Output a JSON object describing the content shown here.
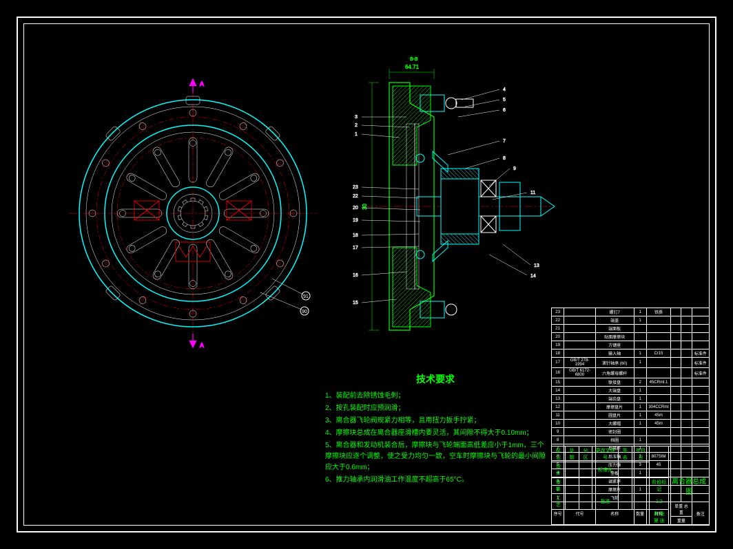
{
  "tech_req": {
    "title": "技术要求",
    "items": [
      "1、装配前去除锈蚀毛刺；",
      "2、按孔装配时应预润滑；",
      "3、离合器飞轮阀规紧力相等，且用扭力扳手拧紧；",
      "4、摩擦块总成在离合器座滑槽内要灵活，其间隙不得大于0.10mm；",
      "5、离合器和发动机装合后，摩擦块与飞轮端面高低差应小于1mm，三个摩擦块应逐个调整，使之受力均匀一致，空车时摩擦块与飞轮的最小间隙应大于0.6mm；",
      "6、推力轴承内润滑油工作温度不超高于65°C。"
    ]
  },
  "parts": [
    {
      "n": "23",
      "code": "",
      "name": "螺钉7",
      "qty": "1",
      "mat": "铁质",
      "wt": "",
      "note": ""
    },
    {
      "n": "22",
      "code": "",
      "name": "端盖",
      "qty": "1",
      "mat": "",
      "wt": "",
      "note": ""
    },
    {
      "n": "21",
      "code": "",
      "name": "端面板",
      "qty": "",
      "mat": "",
      "wt": "",
      "note": ""
    },
    {
      "n": "20",
      "code": "",
      "name": "贴面摩擦块",
      "qty": "",
      "mat": "",
      "wt": "",
      "note": ""
    },
    {
      "n": "19",
      "code": "",
      "name": "方键座",
      "qty": "",
      "mat": "",
      "wt": "",
      "note": ""
    },
    {
      "n": "18",
      "code": "",
      "name": "输入轴",
      "qty": "1",
      "mat": "Cr15",
      "wt": "",
      "note": "标准件"
    },
    {
      "n": "17",
      "code": "GB/T 278-1994",
      "name": "滚针轴承 (60)",
      "qty": "1",
      "mat": "",
      "wt": "",
      "note": "标准件"
    },
    {
      "n": "16",
      "code": "GB/T 6172-6800",
      "name": "六角螺母螺杆",
      "qty": "",
      "mat": "",
      "wt": "",
      "note": "标准件"
    },
    {
      "n": "15",
      "code": "",
      "name": "联接盘",
      "qty": "2",
      "mat": "45CRml.1",
      "wt": "",
      "note": ""
    },
    {
      "n": "14",
      "code": "",
      "name": "大端盘",
      "qty": "1",
      "mat": "",
      "wt": "",
      "note": ""
    },
    {
      "n": "13",
      "code": "",
      "name": "端齿盘",
      "qty": "1",
      "mat": "",
      "wt": "",
      "note": ""
    },
    {
      "n": "12",
      "code": "",
      "name": "摩擦盘片",
      "qty": "1",
      "mat": "304CCRml",
      "wt": "",
      "note": ""
    },
    {
      "n": "11",
      "code": "",
      "name": "圆盘片",
      "qty": "1",
      "mat": "45m",
      "wt": "",
      "note": ""
    },
    {
      "n": "10",
      "code": "",
      "name": "大螺帽",
      "qty": "1",
      "mat": "45m",
      "wt": "",
      "note": ""
    },
    {
      "n": "9",
      "code": "",
      "name": "密封圈",
      "qty": "",
      "mat": "",
      "wt": "",
      "note": ""
    },
    {
      "n": "8",
      "code": "",
      "name": "挡圈",
      "qty": "1",
      "mat": "",
      "wt": "",
      "note": ""
    },
    {
      "n": "7",
      "code": "",
      "name": "后输杆",
      "qty": "1",
      "mat": "",
      "wt": "",
      "note": ""
    },
    {
      "n": "6",
      "code": "",
      "name": "后玉轴",
      "qty": "1",
      "mat": "807SIM",
      "wt": "",
      "note": ""
    },
    {
      "n": "5",
      "code": "",
      "name": "压力弹",
      "qty": "3",
      "mat": "45",
      "wt": "",
      "note": ""
    },
    {
      "n": "4",
      "code": "",
      "name": "垫板",
      "qty": "1",
      "mat": "",
      "wt": "",
      "note": ""
    },
    {
      "n": "3",
      "code": "",
      "name": "调紧环",
      "qty": "",
      "mat": "",
      "wt": "",
      "note": ""
    },
    {
      "n": "2",
      "code": "",
      "name": "摩擦片",
      "qty": "1",
      "mat": "",
      "wt": "",
      "note": ""
    },
    {
      "n": "1",
      "code": "",
      "name": "飞轮",
      "qty": "",
      "mat": "",
      "wt": "",
      "note": ""
    }
  ],
  "parts_header": {
    "n": "序号",
    "code": "代号",
    "name": "名称",
    "qty": "数量",
    "mat": "材料",
    "wt": "单重 总重",
    "note": "备注"
  },
  "parts_header2": {
    "wt": "重量"
  },
  "title_block": {
    "drawing_name": "离合器总成图",
    "row1": {
      "a": "标记",
      "b": "处数",
      "c": "分区",
      "d": "更改文件号",
      "e": "签名",
      "f": "年月日"
    },
    "row2": {
      "a": "设计",
      "b": "",
      "c": "",
      "d": "",
      "e": "标准化",
      "f": ""
    },
    "row3": {
      "a": "审核",
      "b": "",
      "c": "",
      "d": "",
      "e": "",
      "f": ""
    },
    "row4": {
      "a": "工艺",
      "b": "",
      "c": "",
      "d": "批准",
      "e": "",
      "f": ""
    },
    "scale_label": "阶段标记",
    "weight": "重量",
    "scale": "比例",
    "scale_val": "1:2",
    "sheet": "共 张 第 张"
  },
  "dims": {
    "top_dim": "64.71",
    "left_dim": "30",
    "section": "B-B"
  },
  "callouts": {
    "front": [
      "90",
      "91"
    ],
    "section": [
      "1",
      "2",
      "3",
      "4",
      "5",
      "6",
      "7",
      "8",
      "9",
      "11",
      "13",
      "14",
      "15",
      "16",
      "17",
      "18",
      "19",
      "20",
      "22",
      "23"
    ]
  },
  "section_marks": {
    "a": "A",
    "b": "B"
  }
}
